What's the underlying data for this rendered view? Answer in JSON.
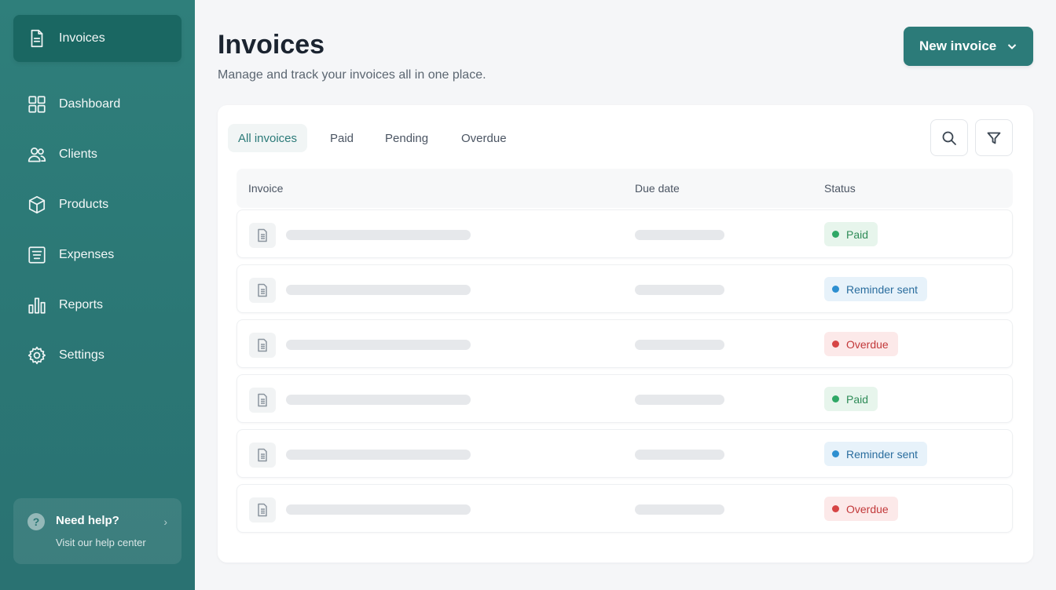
{
  "sidebar": {
    "items": [
      {
        "label": "Invoices",
        "icon": "invoice-icon",
        "active": true
      },
      {
        "label": "Dashboard",
        "icon": "dashboard-icon"
      },
      {
        "label": "Clients",
        "icon": "clients-icon"
      },
      {
        "label": "Products",
        "icon": "box-icon"
      },
      {
        "label": "Expenses",
        "icon": "receipt-icon"
      },
      {
        "label": "Reports",
        "icon": "bar-chart-icon"
      },
      {
        "label": "Settings",
        "icon": "gear-icon"
      }
    ],
    "help": {
      "title": "Need help?",
      "subtitle": "Visit our help center",
      "icon": "question-icon"
    }
  },
  "header": {
    "title": "Invoices",
    "subtitle": "Manage and track your invoices all in one place.",
    "new_button_label": "New invoice"
  },
  "tabs": [
    "All invoices",
    "Paid",
    "Pending",
    "Overdue"
  ],
  "active_tab": "All invoices",
  "table": {
    "columns": [
      "Invoice",
      "Due date",
      "Status"
    ],
    "rows": [
      {
        "status": "Paid",
        "status_type": "paid"
      },
      {
        "status": "Reminder sent",
        "status_type": "reminder"
      },
      {
        "status": "Overdue",
        "status_type": "overdue"
      },
      {
        "status": "Paid",
        "status_type": "paid"
      },
      {
        "status": "Reminder sent",
        "status_type": "reminder"
      },
      {
        "status": "Overdue",
        "status_type": "overdue"
      }
    ]
  },
  "colors": {
    "sidebar": "#2b7775",
    "accent": "#2c7b79",
    "paid": "#2fa866",
    "reminder": "#2e8fd0",
    "overdue": "#d64545"
  }
}
